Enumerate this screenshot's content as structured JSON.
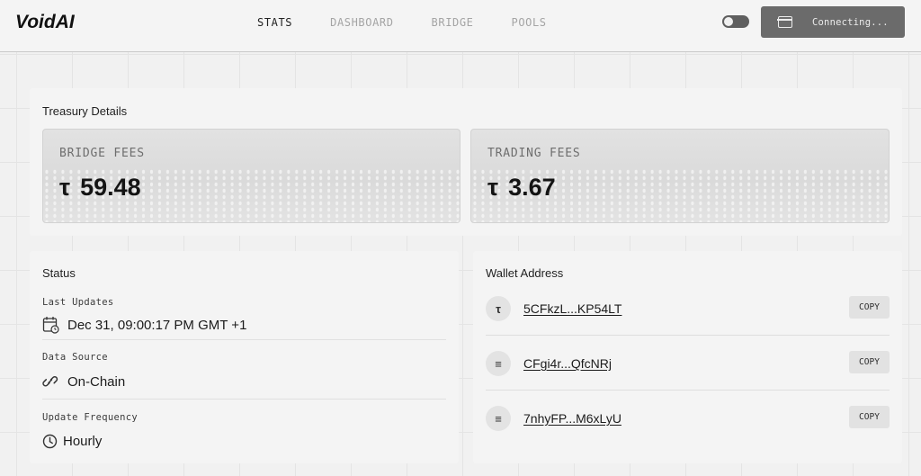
{
  "header": {
    "logo_text": "VoidAI",
    "nav": [
      {
        "label": "STATS"
      },
      {
        "label": "DASHBOARD"
      },
      {
        "label": "BRIDGE"
      },
      {
        "label": "POOLS"
      }
    ],
    "connect_label": "Connecting..."
  },
  "treasury": {
    "title": "Treasury Details",
    "bridge_fees": {
      "label": "BRIDGE FEES",
      "symbol": "τ",
      "value": "59.48"
    },
    "trading_fees": {
      "label": "TRADING FEES",
      "symbol": "τ",
      "value": "3.67"
    }
  },
  "status": {
    "title": "Status",
    "last_updates_label": "Last Updates",
    "last_updates_value": "Dec 31, 09:00:17 PM GMT +1",
    "data_source_label": "Data Source",
    "data_source_value": "On-Chain",
    "frequency_label": "Update Frequency",
    "frequency_value": "Hourly"
  },
  "wallet": {
    "title": "Wallet Address",
    "copy_label": "COPY",
    "addresses": [
      {
        "coin": "τ",
        "coin_icon": "tao-coin-icon",
        "address": "5CFkzL...KP54LT"
      },
      {
        "coin": "≡",
        "coin_icon": "solana-coin-icon",
        "address": "CFgi4r...QfcNRj"
      },
      {
        "coin": "≡",
        "coin_icon": "solana-coin-icon",
        "address": "7nhyFP...M6xLyU"
      }
    ]
  },
  "icons": {
    "calendar": "calendar-icon",
    "link": "link-icon",
    "clock": "clock-icon",
    "wallet": "wallet-icon",
    "theme": "theme-toggle-icon"
  },
  "colors": {
    "accent": "#6b6b6b",
    "background": "#f1f1f1",
    "panel": "#f4f4f4"
  }
}
